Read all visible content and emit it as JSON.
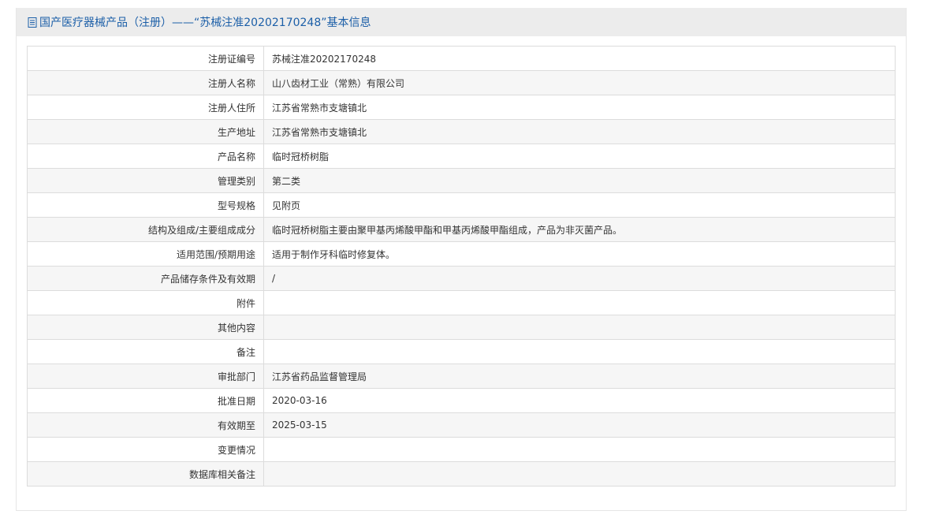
{
  "header": {
    "title": "国产医疗器械产品（注册）——“苏械注准20202170248”基本信息"
  },
  "rows": [
    {
      "label": "注册证编号",
      "value": "苏械注准20202170248"
    },
    {
      "label": "注册人名称",
      "value": "山八齿材工业（常熟）有限公司"
    },
    {
      "label": "注册人住所",
      "value": "江苏省常熟市支塘镇北"
    },
    {
      "label": "生产地址",
      "value": "江苏省常熟市支塘镇北"
    },
    {
      "label": "产品名称",
      "value": "临时冠桥树脂"
    },
    {
      "label": "管理类别",
      "value": "第二类"
    },
    {
      "label": "型号规格",
      "value": "见附页"
    },
    {
      "label": "结构及组成/主要组成成分",
      "value": "临时冠桥树脂主要由聚甲基丙烯酸甲酯和甲基丙烯酸甲酯组成，产品为非灭菌产品。"
    },
    {
      "label": "适用范围/预期用途",
      "value": "适用于制作牙科临时修复体。"
    },
    {
      "label": "产品储存条件及有效期",
      "value": "/"
    },
    {
      "label": "附件",
      "value": ""
    },
    {
      "label": "其他内容",
      "value": ""
    },
    {
      "label": "备注",
      "value": ""
    },
    {
      "label": "审批部门",
      "value": "江苏省药品监督管理局"
    },
    {
      "label": "批准日期",
      "value": "2020-03-16"
    },
    {
      "label": "有效期至",
      "value": "2025-03-15"
    },
    {
      "label": "变更情况",
      "value": ""
    },
    {
      "label": "数据库相关备注",
      "value": ""
    }
  ]
}
